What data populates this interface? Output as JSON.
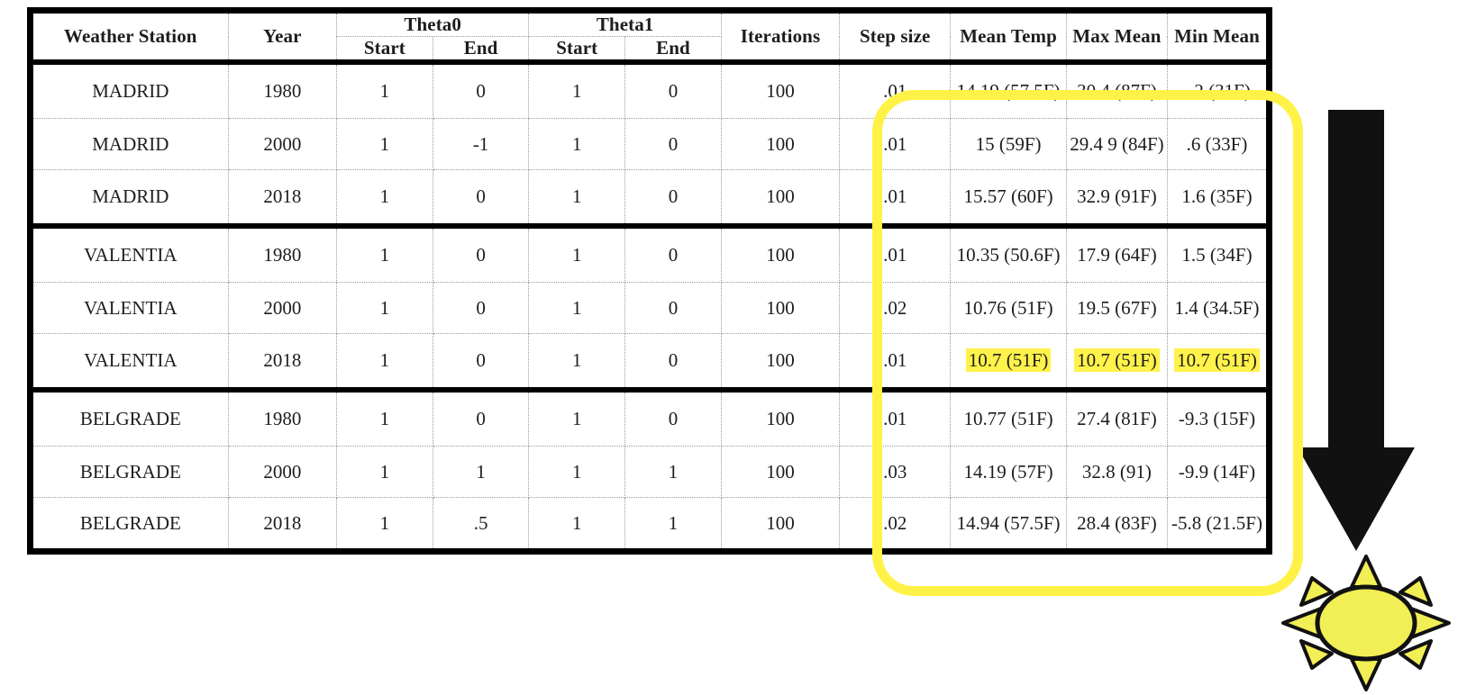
{
  "table": {
    "columns": {
      "weather_station": "Weather Station",
      "year": "Year",
      "theta0": "Theta0",
      "theta1": "Theta1",
      "iterations": "Iterations",
      "step_size": "Step size",
      "mean_temp": "Mean Temp",
      "max_mean": "Max Mean",
      "min_mean": "Min Mean",
      "start": "Start",
      "end": "End",
      "start2": "Start",
      "end2": "End"
    },
    "rows": [
      {
        "station": "MADRID",
        "year": "1980",
        "theta0_start": "1",
        "theta0_end": "0",
        "theta1_start": "1",
        "theta1_end": "0",
        "iterations": "100",
        "step_size": ".01",
        "mean_temp": "14.19 (57.5F)",
        "max_mean": "30.4 (87F)",
        "min_mean": "-.2 (31F)",
        "group_start": true,
        "highlight": false
      },
      {
        "station": "MADRID",
        "year": "2000",
        "theta0_start": "1",
        "theta0_end": "-1",
        "theta1_start": "1",
        "theta1_end": "0",
        "iterations": "100",
        "step_size": ".01",
        "mean_temp": "15 (59F)",
        "max_mean": "29.4 9 (84F)",
        "min_mean": ".6 (33F)",
        "group_start": false,
        "highlight": false
      },
      {
        "station": "MADRID",
        "year": "2018",
        "theta0_start": "1",
        "theta0_end": "0",
        "theta1_start": "1",
        "theta1_end": "0",
        "iterations": "100",
        "step_size": ".01",
        "mean_temp": "15.57 (60F)",
        "max_mean": "32.9 (91F)",
        "min_mean": "1.6 (35F)",
        "group_start": false,
        "highlight": false
      },
      {
        "station": "VALENTIA",
        "year": "1980",
        "theta0_start": "1",
        "theta0_end": "0",
        "theta1_start": "1",
        "theta1_end": "0",
        "iterations": "100",
        "step_size": ".01",
        "mean_temp": "10.35 (50.6F)",
        "max_mean": "17.9 (64F)",
        "min_mean": "1.5 (34F)",
        "group_start": true,
        "highlight": false
      },
      {
        "station": "VALENTIA",
        "year": "2000",
        "theta0_start": "1",
        "theta0_end": "0",
        "theta1_start": "1",
        "theta1_end": "0",
        "iterations": "100",
        "step_size": ".02",
        "mean_temp": "10.76 (51F)",
        "max_mean": "19.5 (67F)",
        "min_mean": "1.4 (34.5F)",
        "group_start": false,
        "highlight": false
      },
      {
        "station": "VALENTIA",
        "year": "2018",
        "theta0_start": "1",
        "theta0_end": "0",
        "theta1_start": "1",
        "theta1_end": "0",
        "iterations": "100",
        "step_size": ".01",
        "mean_temp": "10.7 (51F)",
        "max_mean": "10.7 (51F)",
        "min_mean": "10.7 (51F)",
        "group_start": false,
        "highlight": true
      },
      {
        "station": "BELGRADE",
        "year": "1980",
        "theta0_start": "1",
        "theta0_end": "0",
        "theta1_start": "1",
        "theta1_end": "0",
        "iterations": "100",
        "step_size": ".01",
        "mean_temp": "10.77 (51F)",
        "max_mean": "27.4 (81F)",
        "min_mean": "-9.3 (15F)",
        "group_start": true,
        "highlight": false
      },
      {
        "station": "BELGRADE",
        "year": "2000",
        "theta0_start": "1",
        "theta0_end": "1",
        "theta1_start": "1",
        "theta1_end": "1",
        "iterations": "100",
        "step_size": ".03",
        "mean_temp": "14.19 (57F)",
        "max_mean": "32.8 (91)",
        "min_mean": "-9.9 (14F)",
        "group_start": false,
        "highlight": false
      },
      {
        "station": "BELGRADE",
        "year": "2018",
        "theta0_start": "1",
        "theta0_end": ".5",
        "theta1_start": "1",
        "theta1_end": "1",
        "iterations": "100",
        "step_size": ".02",
        "mean_temp": "14.94 (57.5F)",
        "max_mean": "28.4 (83F)",
        "min_mean": "-5.8 (21.5F)",
        "group_start": false,
        "highlight": false
      }
    ]
  },
  "annotations": {
    "highlight_ring_color": "#fff247",
    "highlight_cell_color": "#fff24a",
    "arrow_color": "#000000",
    "sun_fill_color": "#f2ee55",
    "sun_outline_color": "#000000"
  }
}
